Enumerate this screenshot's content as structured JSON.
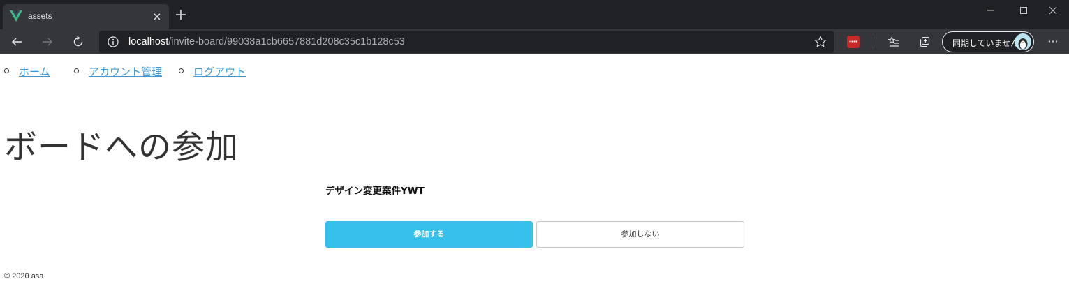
{
  "browser": {
    "tab": {
      "title": "assets",
      "favicon": "vue-logo-icon",
      "close_icon": "×"
    },
    "new_tab_icon": "+",
    "address": {
      "host": "localhost",
      "path": "/invite-board/99038a1cb6657881d208c35c1b128c53"
    },
    "profile": {
      "label": "同期していません"
    },
    "more_icon": "···",
    "colors": {
      "frame": "#202124",
      "toolbar": "#35363a",
      "accent_ext": "#c62828"
    }
  },
  "nav": {
    "items": [
      {
        "label": "ホーム"
      },
      {
        "label": "アカウント管理"
      },
      {
        "label": "ログアウト"
      }
    ]
  },
  "main": {
    "title": "ボードへの参加",
    "board_name": "デザイン変更案件YWT",
    "join_label": "参加する",
    "decline_label": "参加しない"
  },
  "footer": {
    "text": "© 2020 asa"
  },
  "colors": {
    "link": "#3a9ad9",
    "primary_button": "#36c0ec"
  }
}
